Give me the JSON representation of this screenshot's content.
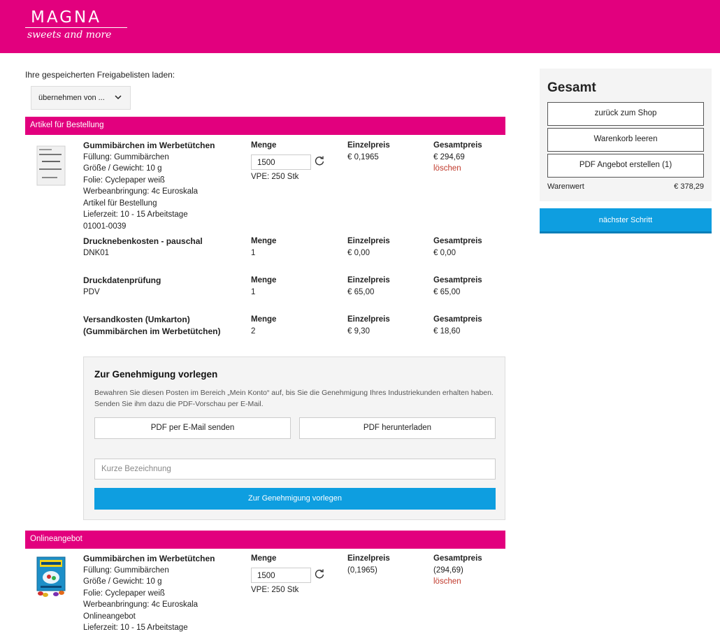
{
  "header": {
    "logo_name": "MAGNA",
    "logo_tagline": "sweets and more",
    "brand_color": "#e2007e"
  },
  "saved_lists": {
    "label": "Ihre gespeicherten Freigabelisten laden:",
    "select_value": "übernehmen von ..."
  },
  "col_headers": {
    "qty": "Menge",
    "unit_price": "Einzelpreis",
    "total_price": "Gesamtpreis"
  },
  "order_section": {
    "title": "Artikel für Bestellung",
    "main_item": {
      "name": "Gummibärchen im Werbetütchen",
      "details": [
        "Füllung: Gummibärchen",
        "Größe / Gewicht: 10 g",
        "Folie: Cyclepaper weiß",
        "Werbeanbringung: 4c Euroskala",
        "Artikel für Bestellung",
        "Lieferzeit: 10 - 15 Arbeitstage",
        "01001-0039"
      ],
      "qty": "1500",
      "vpe": "VPE: 250 Stk",
      "unit_price": "€ 0,1965",
      "total_price": "€ 294,69",
      "delete": "löschen"
    },
    "extra_rows": [
      {
        "name": "Drucknebenkosten - pauschal",
        "code": "DNK01",
        "qty": "1",
        "unit_price": "€ 0,00",
        "total_price": "€ 0,00"
      },
      {
        "name": "Druckdatenprüfung",
        "code": "PDV",
        "qty": "1",
        "unit_price": "€ 65,00",
        "total_price": "€ 65,00"
      },
      {
        "name": "Versandkosten (Umkarton)(Gummibärchen im Werbetütchen)",
        "code": "",
        "qty": "2",
        "unit_price": "€ 9,30",
        "total_price": "€ 18,60"
      }
    ]
  },
  "approval": {
    "title": "Zur Genehmigung vorlegen",
    "text": "Bewahren Sie diesen Posten im Bereich „Mein Konto“ auf, bis Sie die Genehmigung Ihres Industriekunden erhalten haben. Senden Sie ihm dazu die PDF-Vorschau per E-Mail.",
    "btn_email": "PDF per E-Mail senden",
    "btn_download": "PDF herunterladen",
    "input_placeholder": "Kurze Bezeichnung",
    "btn_submit": "Zur Genehmigung vorlegen"
  },
  "online_section": {
    "title": "Onlineangebot",
    "item": {
      "name": "Gummibärchen im Werbetütchen",
      "details": [
        "Füllung: Gummibärchen",
        "Größe / Gewicht: 10 g",
        "Folie: Cyclepaper weiß",
        "Werbeanbringung: 4c Euroskala",
        "Onlineangebot",
        "Lieferzeit: 10 - 15 Arbeitstage"
      ],
      "qty": "1500",
      "vpe": "VPE: 250 Stk",
      "unit_price": "(0,1965)",
      "total_price": "(294,69)",
      "delete": "löschen"
    }
  },
  "sidebar": {
    "title": "Gesamt",
    "btn_back": "zurück zum Shop",
    "btn_clear": "Warenkorb leeren",
    "btn_pdf": "PDF Angebot erstellen (1)",
    "goods_value_label": "Warenwert",
    "goods_value": "€ 378,29",
    "next_step": "nächster Schritt",
    "accent_color": "#0e9ee0"
  }
}
